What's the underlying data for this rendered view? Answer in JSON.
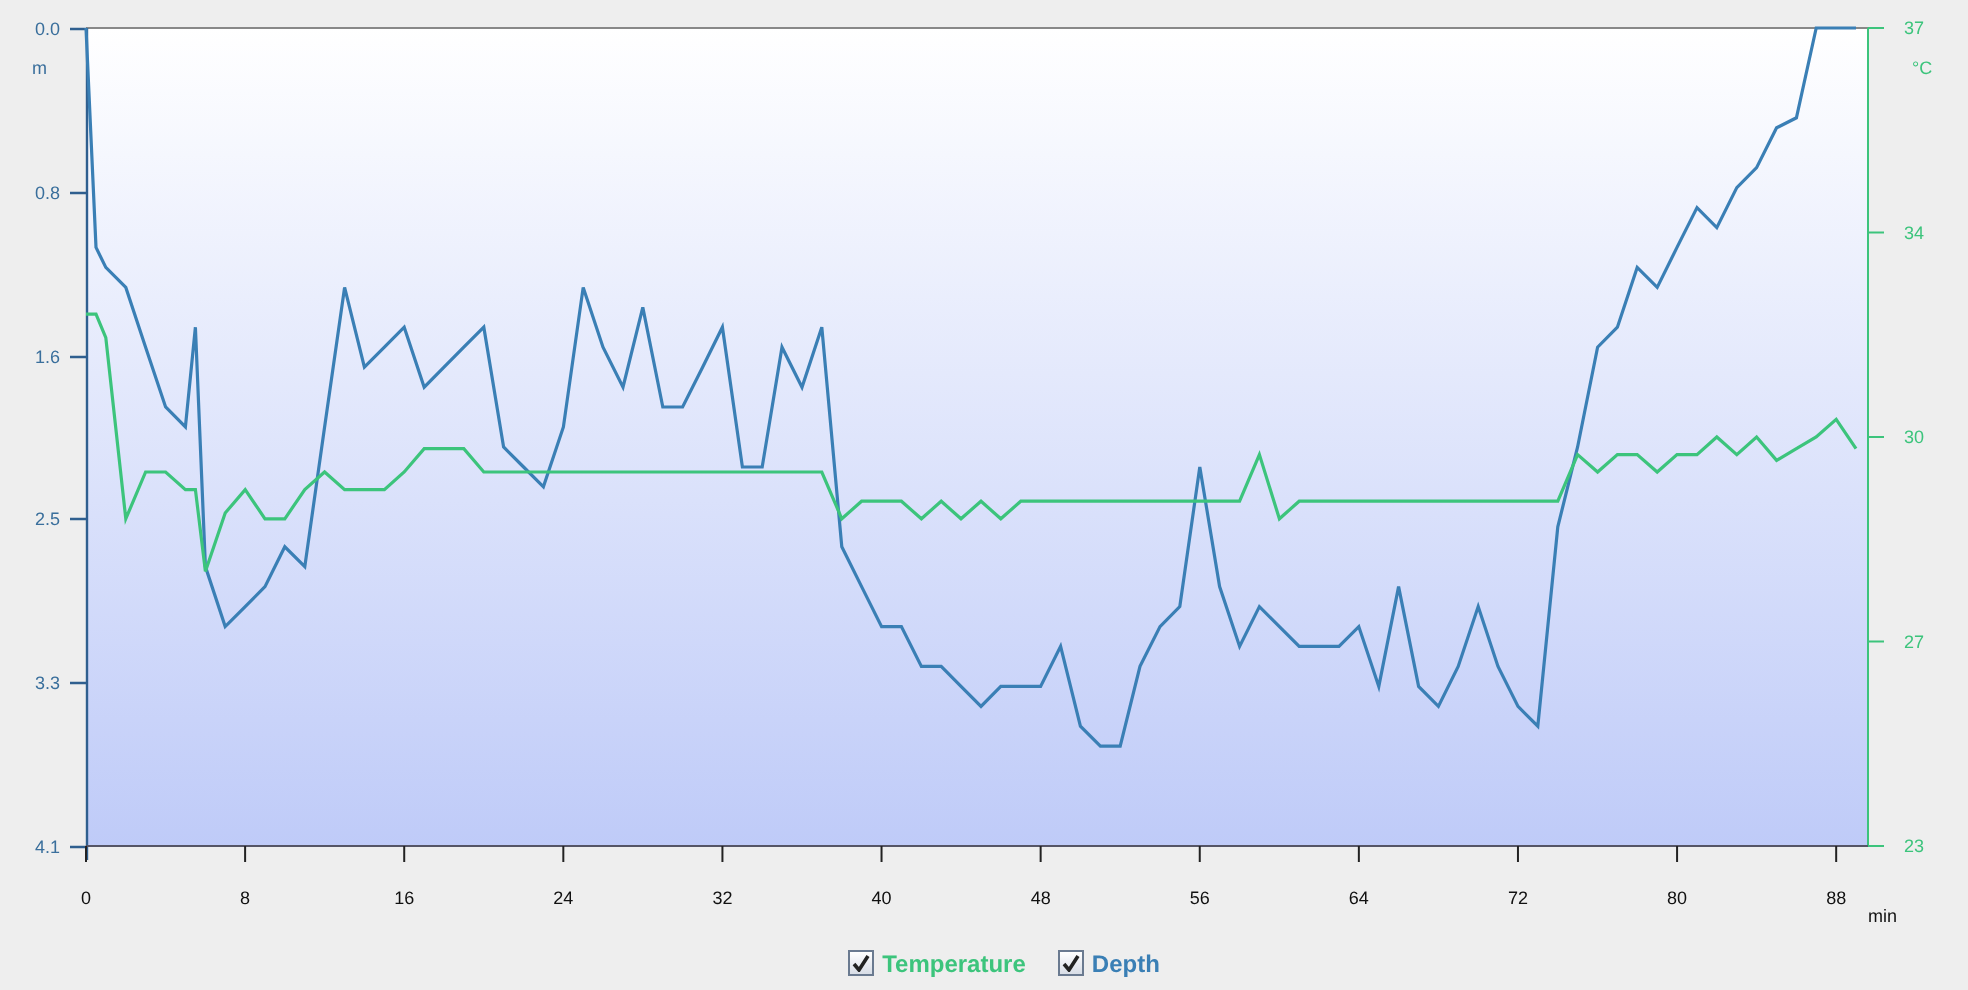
{
  "chart_data": {
    "type": "line",
    "xlabel": "min",
    "ylabel": "m",
    "y2label": "°C",
    "x": [
      0,
      0.5,
      1,
      2,
      3,
      4,
      5,
      5.5,
      6,
      7,
      8,
      9,
      10,
      11,
      12,
      13,
      14,
      15,
      16,
      17,
      18,
      19,
      20,
      21,
      22,
      23,
      24,
      25,
      26,
      27,
      28,
      29,
      30,
      31,
      32,
      33,
      34,
      35,
      36,
      37,
      38,
      39,
      40,
      41,
      42,
      43,
      44,
      45,
      46,
      47,
      48,
      49,
      50,
      51,
      52,
      53,
      54,
      55,
      56,
      57,
      58,
      59,
      60,
      61,
      62,
      63,
      64,
      65,
      66,
      67,
      68,
      69,
      70,
      71,
      72,
      73,
      74,
      75,
      76,
      77,
      78,
      79,
      80,
      81,
      82,
      83,
      84,
      85,
      86,
      87,
      88,
      89
    ],
    "series": [
      {
        "name": "Depth",
        "color": "#3a7fb5",
        "values": [
          0.0,
          1.1,
          1.2,
          1.3,
          1.6,
          1.9,
          2.0,
          1.5,
          2.7,
          3.0,
          2.9,
          2.8,
          2.6,
          2.7,
          2.0,
          1.3,
          1.7,
          1.6,
          1.5,
          1.8,
          1.7,
          1.6,
          1.5,
          2.1,
          2.2,
          2.3,
          2.0,
          1.3,
          1.6,
          1.8,
          1.4,
          1.9,
          1.9,
          1.7,
          1.5,
          2.2,
          2.2,
          1.6,
          1.8,
          1.5,
          2.6,
          2.8,
          3.0,
          3.0,
          3.2,
          3.2,
          3.3,
          3.4,
          3.3,
          3.3,
          3.3,
          3.1,
          3.5,
          3.6,
          3.6,
          3.2,
          3.0,
          2.9,
          2.2,
          2.8,
          3.1,
          2.9,
          3.0,
          3.1,
          3.1,
          3.1,
          3.0,
          3.3,
          2.8,
          3.3,
          3.4,
          3.2,
          2.9,
          3.2,
          3.4,
          3.5,
          2.5,
          2.1,
          1.6,
          1.5,
          1.2,
          1.3,
          1.1,
          0.9,
          1.0,
          0.8,
          0.7,
          0.5,
          0.45,
          0.0,
          0.0,
          0.0
        ]
      },
      {
        "name": "Temperature",
        "color": "#3cc47c",
        "axis": "y2",
        "values": [
          32.1,
          32.1,
          31.7,
          28.6,
          29.4,
          29.4,
          29.1,
          29.1,
          27.7,
          28.7,
          29.1,
          28.6,
          28.6,
          29.1,
          29.4,
          29.1,
          29.1,
          29.1,
          29.4,
          29.8,
          29.8,
          29.8,
          29.4,
          29.4,
          29.4,
          29.4,
          29.4,
          29.4,
          29.4,
          29.4,
          29.4,
          29.4,
          29.4,
          29.4,
          29.4,
          29.4,
          29.4,
          29.4,
          29.4,
          29.4,
          28.6,
          28.9,
          28.9,
          28.9,
          28.6,
          28.9,
          28.6,
          28.9,
          28.6,
          28.9,
          28.9,
          28.9,
          28.9,
          28.9,
          28.9,
          28.9,
          28.9,
          28.9,
          28.9,
          28.9,
          28.9,
          29.7,
          28.6,
          28.9,
          28.9,
          28.9,
          28.9,
          28.9,
          28.9,
          28.9,
          28.9,
          28.9,
          28.9,
          28.9,
          28.9,
          28.9,
          28.9,
          29.7,
          29.4,
          29.7,
          29.7,
          29.4,
          29.7,
          29.7,
          30.0,
          29.7,
          30.0,
          29.6,
          29.8,
          30.0,
          30.3,
          29.8
        ]
      }
    ],
    "xlim": [
      0,
      89.6
    ],
    "ylim": [
      4.1,
      0
    ],
    "y2lim": [
      23,
      37
    ],
    "xticks": [
      0,
      8,
      16,
      24,
      32,
      40,
      48,
      56,
      64,
      72,
      80,
      88
    ],
    "yticks": [
      {
        "value": 0,
        "label": "0.0"
      },
      {
        "value": 0.82,
        "label": "0.8"
      },
      {
        "value": 1.64,
        "label": "1.6"
      },
      {
        "value": 2.46,
        "label": "2.5"
      },
      {
        "value": 3.28,
        "label": "3.3"
      },
      {
        "value": 4.1,
        "label": "4.1"
      }
    ],
    "y2ticks": [
      {
        "value": 37,
        "label": "37"
      },
      {
        "value": 33.5,
        "label": "34"
      },
      {
        "value": 30,
        "label": "30"
      },
      {
        "value": 26.5,
        "label": "27"
      },
      {
        "value": 23,
        "label": "23"
      }
    ]
  },
  "legend": [
    {
      "checked": true
    },
    {
      "checked": true
    }
  ]
}
